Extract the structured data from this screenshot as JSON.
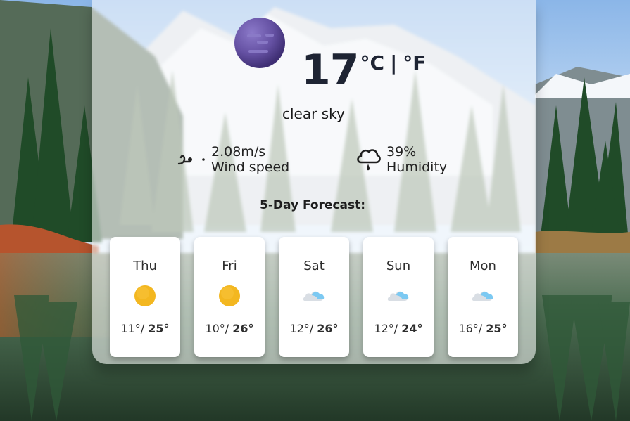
{
  "weather": {
    "temperature": "17",
    "unit_c": "°C",
    "separator": "|",
    "unit_f": "°F",
    "description": "clear sky",
    "wind": {
      "value": "2.08m/s",
      "label": "Wind speed",
      "icon": "wind-icon"
    },
    "humidity": {
      "value": "39%",
      "label": "Humidity",
      "icon": "humidity-icon"
    }
  },
  "forecast": {
    "title": "5-Day Forecast:",
    "days": [
      {
        "day": "Thu",
        "min": "11°",
        "separator": "/",
        "max": "25°",
        "icon": "sun-icon"
      },
      {
        "day": "Fri",
        "min": "10°",
        "separator": "/",
        "max": "26°",
        "icon": "sun-icon"
      },
      {
        "day": "Sat",
        "min": "12°",
        "separator": "/",
        "max": "26°",
        "icon": "cloud-icon"
      },
      {
        "day": "Sun",
        "min": "12°",
        "separator": "/",
        "max": "24°",
        "icon": "cloud-icon"
      },
      {
        "day": "Mon",
        "min": "16°",
        "separator": "/",
        "max": "25°",
        "icon": "cloud-icon"
      }
    ]
  },
  "colors": {
    "card_bg": "#ffffff",
    "text_primary": "#1e2433",
    "sun_fill": "#f3b720",
    "moon_fill": "#6f5ca8"
  }
}
